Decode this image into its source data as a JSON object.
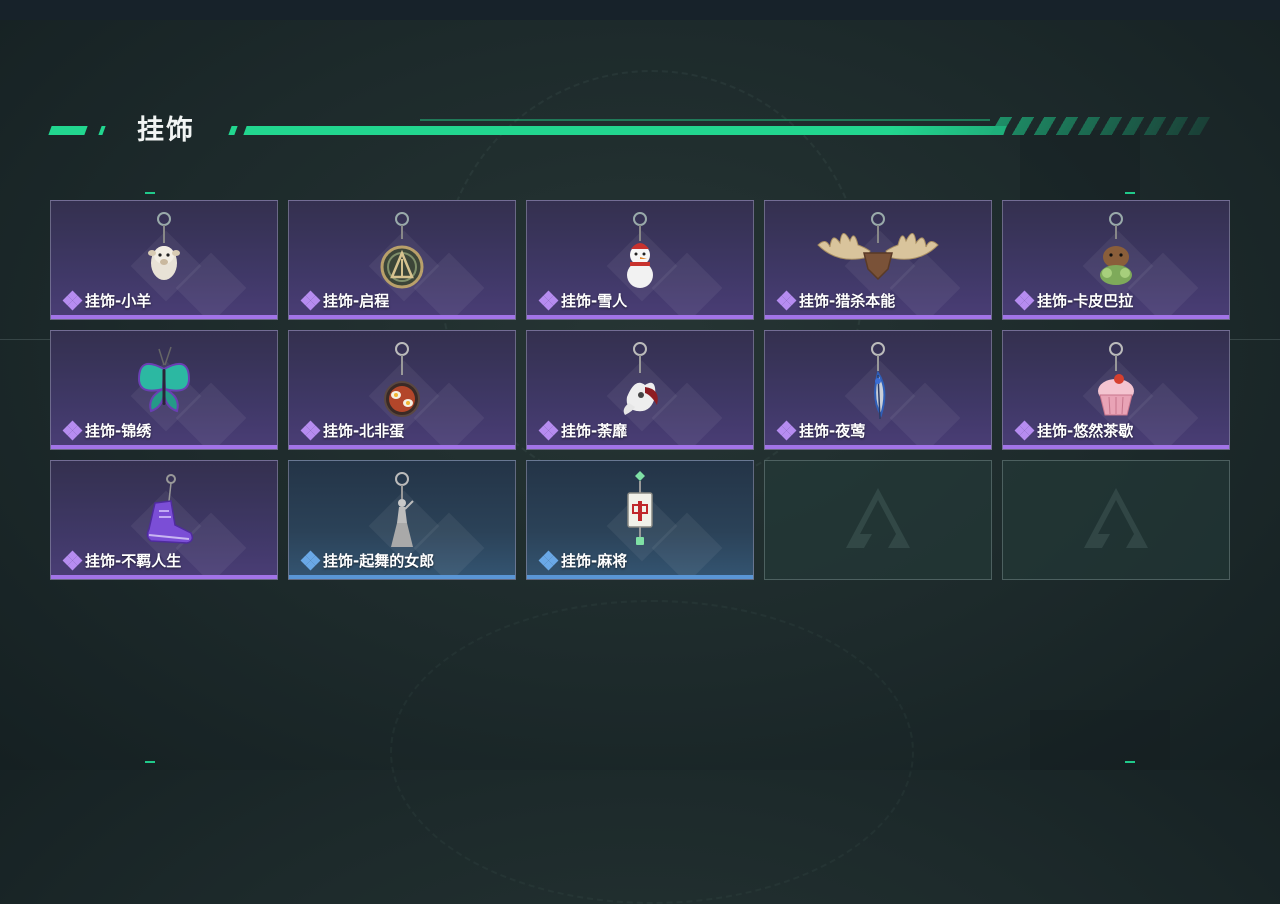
{
  "section": {
    "title": "挂饰"
  },
  "colors": {
    "accent": "#22d68f",
    "purple_rarity": "#a274e8",
    "blue_rarity": "#5a96d6"
  },
  "items": [
    {
      "label": "挂饰-小羊",
      "rarity": "purple",
      "icon": "sheep-charm-icon"
    },
    {
      "label": "挂饰-启程",
      "rarity": "purple",
      "icon": "medallion-charm-icon"
    },
    {
      "label": "挂饰-雪人",
      "rarity": "purple",
      "icon": "snowman-charm-icon"
    },
    {
      "label": "挂饰-猎杀本能",
      "rarity": "purple",
      "icon": "antler-charm-icon"
    },
    {
      "label": "挂饰-卡皮巴拉",
      "rarity": "purple",
      "icon": "capybara-charm-icon"
    },
    {
      "label": "挂饰-锦绣",
      "rarity": "purple",
      "icon": "butterfly-charm-icon"
    },
    {
      "label": "挂饰-北非蛋",
      "rarity": "purple",
      "icon": "shakshuka-charm-icon"
    },
    {
      "label": "挂饰-荼靡",
      "rarity": "purple",
      "icon": "flower-charm-icon"
    },
    {
      "label": "挂饰-夜莺",
      "rarity": "purple",
      "icon": "feather-charm-icon"
    },
    {
      "label": "挂饰-悠然茶歇",
      "rarity": "purple",
      "icon": "cupcake-charm-icon"
    },
    {
      "label": "挂饰-不羁人生",
      "rarity": "purple",
      "icon": "sneaker-charm-icon"
    },
    {
      "label": "挂饰-起舞的女郎",
      "rarity": "blue",
      "icon": "dancer-charm-icon"
    },
    {
      "label": "挂饰-麻将",
      "rarity": "blue",
      "icon": "mahjong-charm-icon"
    }
  ],
  "empty_slots": 2
}
